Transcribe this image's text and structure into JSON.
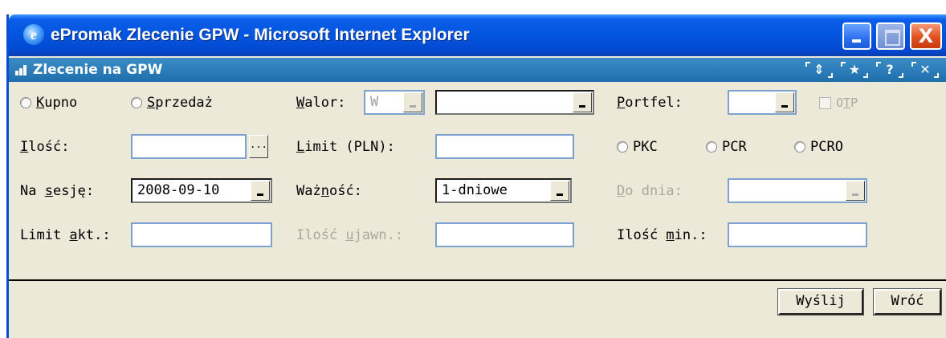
{
  "window": {
    "title": "ePromak Zlecenie GPW - Microsoft Internet Explorer",
    "close_glyph": "X"
  },
  "panel": {
    "title": "Zlecenie na GPW",
    "tools": [
      "⇕",
      "★",
      "?",
      "✕"
    ]
  },
  "form": {
    "kupno": {
      "pre": "",
      "ul": "K",
      "post": "upno"
    },
    "sprzedaz": {
      "pre": "",
      "ul": "S",
      "post": "przedaż"
    },
    "walor": {
      "pre": "",
      "ul": "W",
      "post": "alor:"
    },
    "walor_code_value": "W",
    "walor_name_value": "",
    "portfel": {
      "pre": "",
      "ul": "P",
      "post": "ortfel:"
    },
    "portfel_value": "",
    "otp": {
      "pre": "O",
      "ul": "T",
      "post": "P"
    },
    "ilosc": {
      "pre": "",
      "ul": "I",
      "post": "lość:"
    },
    "ilosc_value": "",
    "ellipsis": "...",
    "limit": {
      "pre": "",
      "ul": "L",
      "post": "imit (PLN):"
    },
    "limit_value": "",
    "pkc": "PKC",
    "pcr": "PCR",
    "pcro": "PCRO",
    "na_sesje": {
      "pre": "Na ",
      "ul": "s",
      "post": "esję:"
    },
    "na_sesje_value": "2008-09-10",
    "waznosc": {
      "pre": "Waż",
      "ul": "n",
      "post": "ość:"
    },
    "waznosc_value": "1-dniowe",
    "do_dnia": {
      "pre": "",
      "ul": "D",
      "post": "o dnia:"
    },
    "do_dnia_value": "",
    "limit_akt": {
      "pre": "Limit ",
      "ul": "a",
      "post": "kt.:"
    },
    "limit_akt_value": "",
    "ilosc_ujawn": {
      "pre": "Ilość ",
      "ul": "u",
      "post": "jawn.:"
    },
    "ilosc_ujawn_value": "",
    "ilosc_min": {
      "pre": "Ilość ",
      "ul": "m",
      "post": "in.:"
    },
    "ilosc_min_value": ""
  },
  "buttons": {
    "send": "Wyślij",
    "back": "Wróć"
  }
}
